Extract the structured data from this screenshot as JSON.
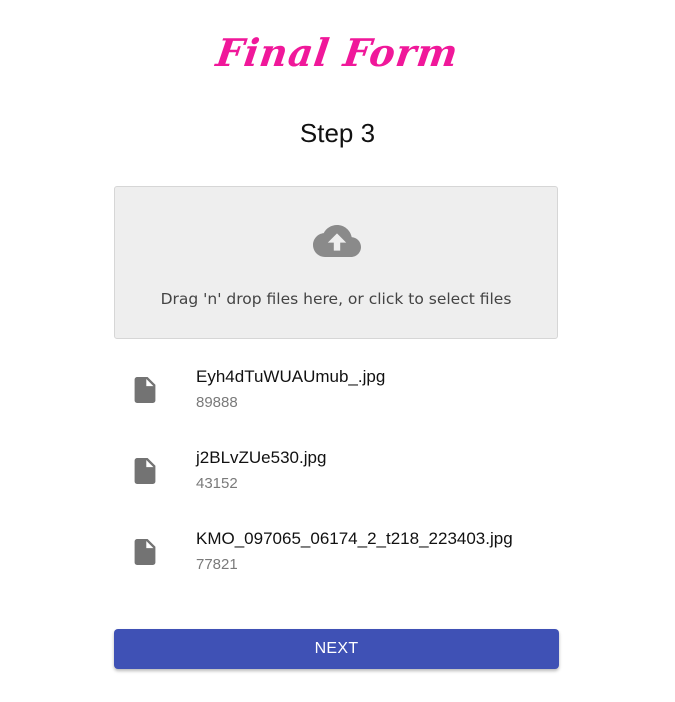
{
  "header": {
    "title": "Final Form",
    "accent_color": "#f0189a"
  },
  "step": {
    "title": "Step 3"
  },
  "dropzone": {
    "icon": "cloud-upload-icon",
    "text": "Drag 'n' drop files here, or click to select files"
  },
  "files": [
    {
      "icon": "file-icon",
      "name": "Eyh4dTuWUAUmub_.jpg",
      "size": "89888"
    },
    {
      "icon": "file-icon",
      "name": "j2BLvZUe530.jpg",
      "size": "43152"
    },
    {
      "icon": "file-icon",
      "name": "KMO_097065_06174_2_t218_223403.jpg",
      "size": "77821"
    }
  ],
  "actions": {
    "next_label": "NEXT",
    "button_color": "#3f51b5"
  }
}
